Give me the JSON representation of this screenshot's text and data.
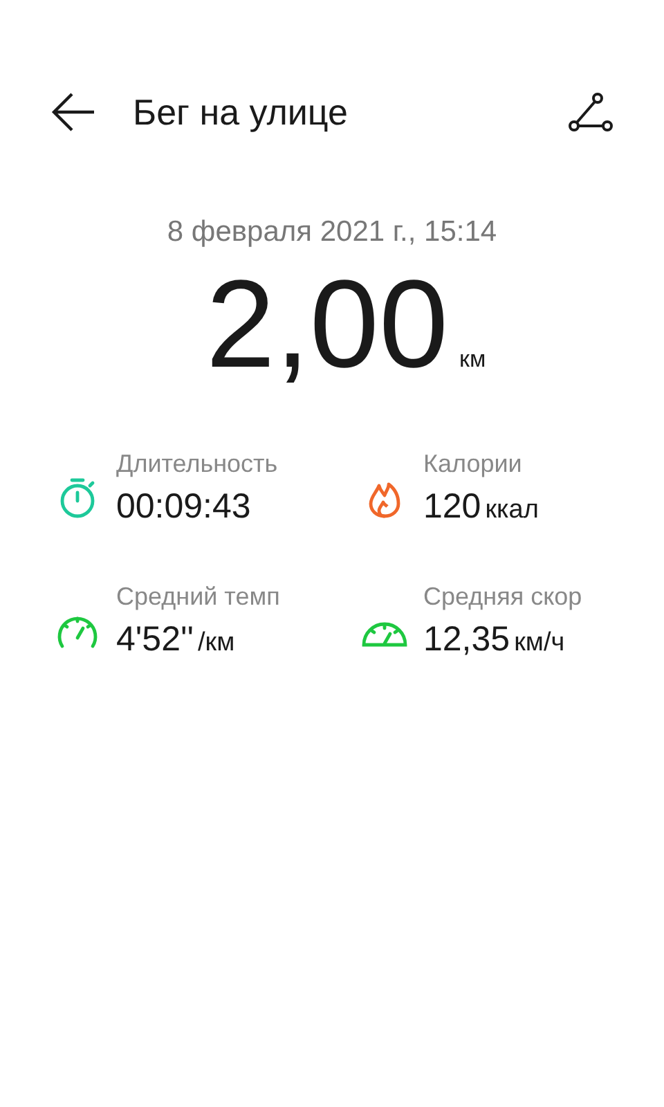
{
  "header": {
    "title": "Бег на улице"
  },
  "date": "8 февраля 2021 г., 15:14",
  "distance": {
    "value": "2,00",
    "unit": "км"
  },
  "stats": [
    {
      "kind": "duration",
      "label": "Длительность",
      "value": "00:09:43"
    },
    {
      "kind": "calories",
      "label": "Калории",
      "value": "120",
      "unit": "ккал"
    },
    {
      "kind": "pace",
      "label": "Средний темп",
      "value": "4'52''",
      "unit": "/км"
    },
    {
      "kind": "speed",
      "label": "Средняя скор",
      "value": "12,35",
      "unit": "км/ч"
    }
  ]
}
